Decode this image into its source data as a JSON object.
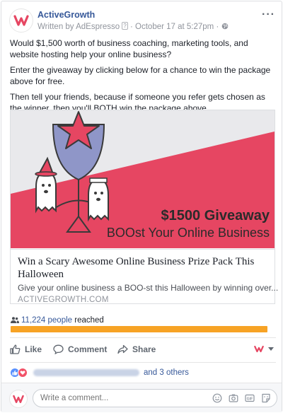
{
  "post": {
    "page_name": "ActiveGrowth",
    "written_by": "Written by AdEspresso",
    "question_badge": "?",
    "date": "October 17 at 5:27pm",
    "separator": "·",
    "more": "···",
    "paragraphs": [
      "Would $1,500 worth of business coaching, marketing tools, and website hosting help your online business?",
      "Enter the giveaway by clicking below for a chance to win the package above for free.",
      "Then tell your friends, because if someone you refer gets chosen as the winner, then you'll BOTH win the package above."
    ]
  },
  "preview": {
    "image_headline": "$1500 Giveaway",
    "image_subhead": "BOOst Your Online Business",
    "title": "Win a Scary Awesome Online Business Prize Pack This Halloween",
    "description": "Give your online business a BOO-st this Halloween by winning over...",
    "domain": "ACTIVEGROWTH.COM"
  },
  "reach": {
    "count": "11,224 people",
    "suffix": " reached",
    "fill_fraction": 1.0
  },
  "actions": {
    "like": "Like",
    "comment": "Comment",
    "share": "Share"
  },
  "reactions": {
    "others": "and 3 others"
  },
  "comment": {
    "placeholder": "Write a comment..."
  },
  "colors": {
    "brand_red": "#e64662",
    "link_blue": "#365899",
    "reach_orange": "#f7a325",
    "image_bg": "#e9e9ec",
    "balloon": "#8f96c8"
  }
}
